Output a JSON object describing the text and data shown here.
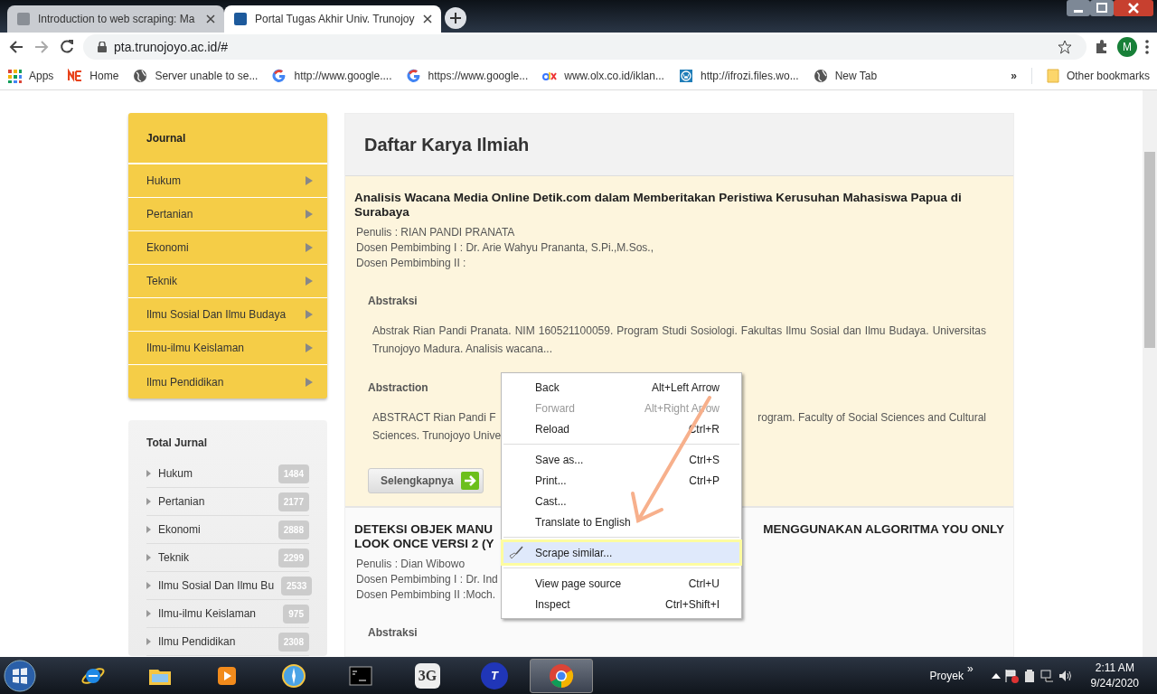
{
  "browser": {
    "tabs": [
      {
        "title": "Introduction to web scraping: Ma",
        "selected": false
      },
      {
        "title": "Portal Tugas Akhir Univ. Trunojoy",
        "selected": true
      }
    ],
    "url": "pta.trunojoyo.ac.id/#",
    "profile": "M",
    "bookmarks": [
      {
        "label": "Apps",
        "kind": "apps"
      },
      {
        "label": "Home",
        "kind": "logo"
      },
      {
        "label": "Server unable to se...",
        "kind": "globe"
      },
      {
        "label": "http://www.google....",
        "kind": "google"
      },
      {
        "label": "https://www.google...",
        "kind": "google"
      },
      {
        "label": "www.olx.co.id/iklan...",
        "kind": "olx"
      },
      {
        "label": "http://ifrozi.files.wo...",
        "kind": "wordpress"
      },
      {
        "label": "New Tab",
        "kind": "globe"
      }
    ],
    "bookmarks_overflow": "»",
    "other_bookmarks": "Other bookmarks"
  },
  "sidebar": {
    "heading": "Journal",
    "items": [
      "Hukum",
      "Pertanian",
      "Ekonomi",
      "Teknik",
      "Ilmu Sosial Dan Ilmu Budaya",
      "Ilmu-ilmu Keislaman",
      "Ilmu Pendidikan"
    ],
    "totals_heading": "Total Jurnal",
    "totals": [
      {
        "label": "Hukum",
        "count": "1484"
      },
      {
        "label": "Pertanian",
        "count": "2177"
      },
      {
        "label": "Ekonomi",
        "count": "2888"
      },
      {
        "label": "Teknik",
        "count": "2299"
      },
      {
        "label": "Ilmu Sosial Dan Ilmu Bu",
        "count": "2533"
      },
      {
        "label": "Ilmu-ilmu Keislaman",
        "count": "975"
      },
      {
        "label": "Ilmu Pendidikan",
        "count": "2308"
      }
    ]
  },
  "main": {
    "title": "Daftar Karya Ilmiah",
    "articles": [
      {
        "highlighted": true,
        "title": [
          [
            "Analisis Wacana Media Online Detik.com dalam Memberitakan Peristiwa Kerusuhan Mahasiswa Papua di Surabaya"
          ]
        ],
        "details": [
          "Penulis : RIAN PANDI PRANATA",
          "Dosen Pembimbing I : Dr. Arie Wahyu Prananta, S.Pi.,M.Sos.,",
          "Dosen Pembimbing II :"
        ],
        "sections": [
          {
            "heading": "Abstraksi",
            "lines": [
              [
                "Abstrak Rian Pandi Pranata. NIM 160521100059. Program Studi Sosiologi. Fakultas Ilmu Sosial dan Ilmu Budaya. Universitas Trunojoyo Madura. Analisis wacana..."
              ]
            ]
          },
          {
            "heading": "Abstraction",
            "lines": [
              [
                "ABSTRACT Rian Pandi F",
                "rogram. Faculty of Social Sciences and Cultural"
              ],
              [
                "Sciences. Trunojoyo Unive"
              ]
            ]
          }
        ],
        "button": "Selengkapnya"
      },
      {
        "highlighted": false,
        "title": [
          [
            "DETEKSI OBJEK MANU",
            "MENGGUNAKAN ALGORITMA YOU ONLY"
          ],
          [
            "LOOK ONCE VERSI 2 (Y"
          ]
        ],
        "details": [
          "Penulis : Dian Wibowo",
          "Dosen Pembimbing I : Dr. Ind",
          "Dosen Pembimbing II :Moch."
        ],
        "sections": [
          {
            "heading": "Abstraksi"
          }
        ]
      }
    ]
  },
  "context_menu": {
    "items": [
      {
        "kind": "item",
        "label": "Back",
        "shortcut": "Alt+Left Arrow",
        "disabled": false,
        "selected": false
      },
      {
        "kind": "item",
        "label": "Forward",
        "shortcut": "Alt+Right Arrow",
        "disabled": true,
        "selected": false
      },
      {
        "kind": "item",
        "label": "Reload",
        "shortcut": "Ctrl+R",
        "disabled": false,
        "selected": false
      },
      {
        "kind": "separator"
      },
      {
        "kind": "item",
        "label": "Save as...",
        "shortcut": "Ctrl+S",
        "disabled": false,
        "selected": false
      },
      {
        "kind": "item",
        "label": "Print...",
        "shortcut": "Ctrl+P",
        "disabled": false,
        "selected": false
      },
      {
        "kind": "item",
        "label": "Cast...",
        "disabled": false,
        "selected": false
      },
      {
        "kind": "item",
        "label": "Translate to English",
        "disabled": false,
        "selected": false
      },
      {
        "kind": "separator"
      },
      {
        "kind": "tool",
        "label": "Scrape similar...",
        "disabled": false,
        "selected": true
      },
      {
        "kind": "separator"
      },
      {
        "kind": "item",
        "label": "View page source",
        "shortcut": "Ctrl+U",
        "disabled": false,
        "selected": false
      },
      {
        "kind": "item",
        "label": "Inspect",
        "shortcut": "Ctrl+Shift+I",
        "disabled": false,
        "selected": false
      }
    ]
  },
  "taskbar": {
    "apps": [
      {
        "kind": "ie",
        "selected": false
      },
      {
        "kind": "folder",
        "selected": false
      },
      {
        "kind": "media",
        "selected": false
      },
      {
        "kind": "compass",
        "selected": false
      },
      {
        "kind": "cmd",
        "selected": false
      },
      {
        "kind": "text",
        "label": "3G",
        "selected": false
      },
      {
        "kind": "text",
        "label": "T",
        "selected": false
      },
      {
        "kind": "chrome",
        "selected": true
      }
    ],
    "toolbar_label": "Proyek",
    "toolbar_overflow": "»",
    "time": "2:11 AM",
    "date": "9/24/2020"
  }
}
